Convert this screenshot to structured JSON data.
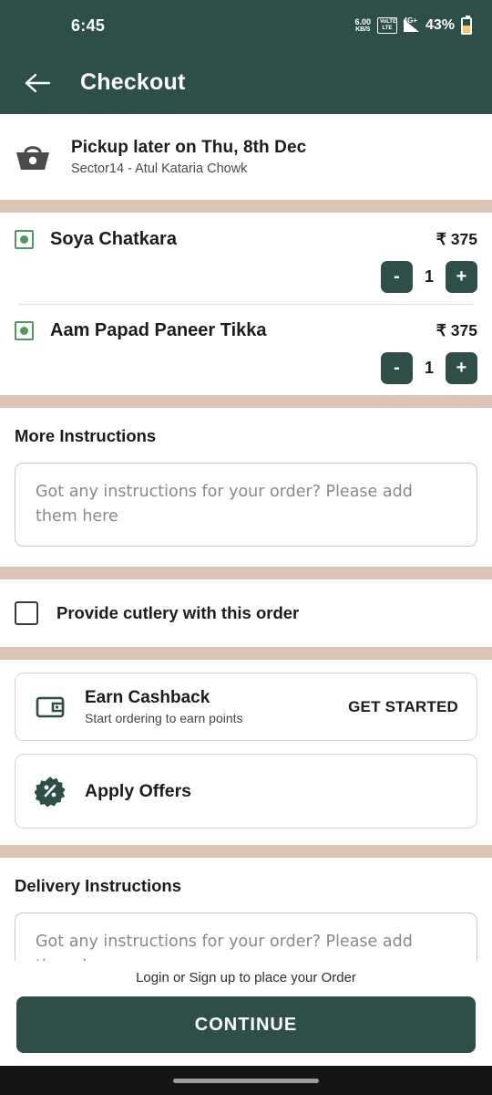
{
  "statusbar": {
    "time": "6:45",
    "data_rate": "6.00",
    "data_unit": "KB/S",
    "volte_top": "VoLTE",
    "volte_bottom": "LTE",
    "network": "4G+",
    "battery_percent": "43%",
    "icons": [
      "signal-icon",
      "battery-icon"
    ]
  },
  "header": {
    "back_icon": "arrow-left-icon",
    "title": "Checkout",
    "bg_color": "#2D4F47"
  },
  "pickup": {
    "icon": "basket-icon",
    "title": "Pickup later on Thu, 8th Dec",
    "subtitle": "Sector14 - Atul Kataria Chowk"
  },
  "cart": {
    "items": [
      {
        "veg_indicator": "veg-icon",
        "name": "Soya Chatkara",
        "price": "₹ 375",
        "quantity": "1",
        "decrement_label": "-",
        "increment_label": "+"
      },
      {
        "veg_indicator": "veg-icon",
        "name": "Aam Papad Paneer Tikka",
        "price": "₹ 375",
        "quantity": "1",
        "decrement_label": "-",
        "increment_label": "+"
      }
    ]
  },
  "more_instructions": {
    "title": "More Instructions",
    "placeholder": "Got any instructions for your order? Please add them here",
    "value": ""
  },
  "cutlery": {
    "label": "Provide cutlery with this order",
    "checked": false
  },
  "cashback_card": {
    "icon": "wallet-icon",
    "title": "Earn Cashback",
    "subtitle": "Start ordering to earn points",
    "cta": "GET STARTED"
  },
  "offers_card": {
    "icon": "percent-badge-icon",
    "title": "Apply Offers"
  },
  "delivery_instructions": {
    "title": "Delivery Instructions",
    "placeholder": "Got any instructions for your order? Please add them here",
    "value": ""
  },
  "footer": {
    "login_note": "Login or Sign up to place your Order",
    "continue_label": "CONTINUE"
  },
  "colors": {
    "brand_green": "#2D4F47",
    "band_tan": "#DCC5B6",
    "veg_green": "#4C9A5C",
    "border_tan": "#D9C3B4"
  }
}
